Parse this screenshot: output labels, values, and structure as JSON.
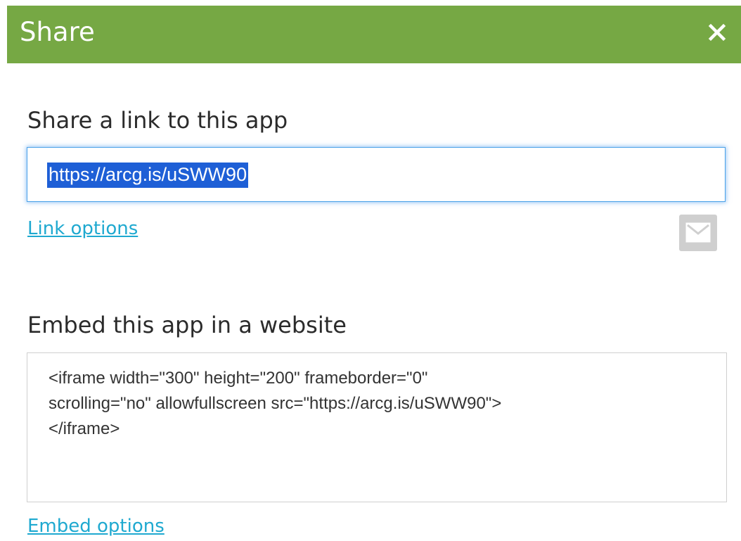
{
  "dialog": {
    "title": "Share",
    "close_icon": "close-icon"
  },
  "share_link": {
    "label": "Share a link to this app",
    "url": "https://arcg.is/uSWW90",
    "options_label": "Link options",
    "email_icon": "email-icon"
  },
  "embed": {
    "label": "Embed this app in a website",
    "code": "<iframe width=\"300\" height=\"200\" frameborder=\"0\"\nscrolling=\"no\" allowfullscreen src=\"https://arcg.is/uSWW90\">\n</iframe>",
    "options_label": "Embed options"
  },
  "colors": {
    "header_bg": "#76a844",
    "link_color": "#1fa9d0",
    "selection_bg": "#1e5fd6",
    "focus_border": "#4aa1e8"
  }
}
